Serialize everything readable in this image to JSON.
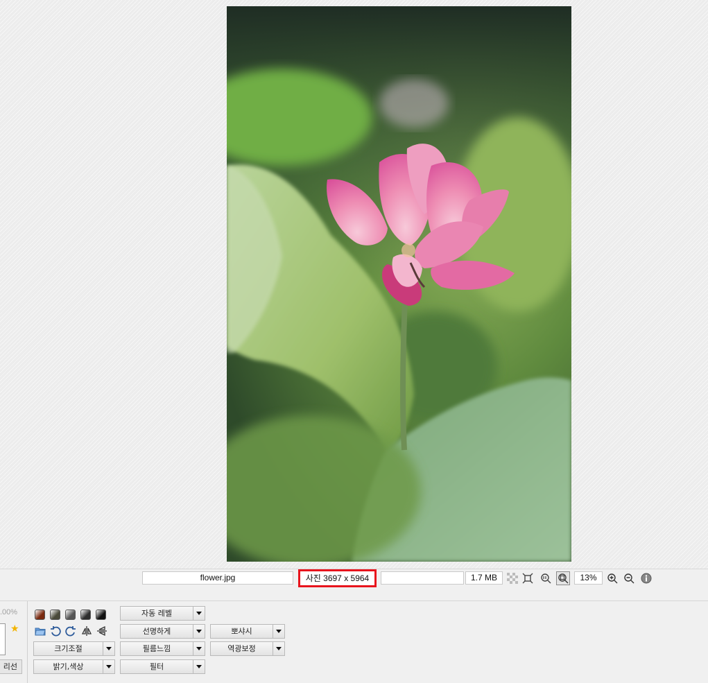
{
  "statusbar": {
    "filename": "flower.jpg",
    "dimensions": "사진 3697 x 5964",
    "blank": "",
    "filesize": "1.7 MB",
    "zoom": "13%",
    "highlight_color": "#e8141d"
  },
  "toolbar": {
    "left_fragment": {
      "percent": ".00%",
      "button_fragment": "리선"
    },
    "swatches": [
      "#7a2a10",
      "#4a4a3a",
      "#555555",
      "#2e2e2e",
      "#111111"
    ],
    "tool_icons": [
      "open-folder-icon",
      "rotate-left-icon",
      "rotate-right-icon",
      "flip-horizontal-icon",
      "flip-vertical-icon"
    ],
    "buttons": {
      "resize": "크기조절",
      "brightness_color": "밝기,색상",
      "auto_level": "자동 레벨",
      "sharpen": "선명하게",
      "film_feel": "필름느낌",
      "filter": "필터",
      "soft_focus": "뽀샤시",
      "backlight_correction": "역광보정"
    }
  }
}
